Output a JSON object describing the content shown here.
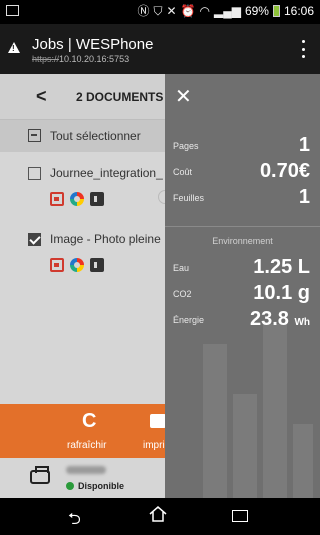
{
  "status_bar": {
    "battery": "69%",
    "time": "16:06"
  },
  "app_bar": {
    "title": "Jobs | WESPhone",
    "url_scheme": "https://",
    "url_host": "10.10.20.16:5753"
  },
  "doc_list": {
    "header": "2 DOCUMENTS",
    "select_all": "Tout sélectionner",
    "documents": [
      {
        "name": "Journee_integration_",
        "checked": false
      },
      {
        "name": "Image - Photo pleine",
        "checked": true
      }
    ]
  },
  "actions": {
    "refresh_label": "rafraîchir",
    "print_label": "impri"
  },
  "printer": {
    "status": "Disponible"
  },
  "summary": {
    "pages_label": "Pages",
    "pages_value": "1",
    "cost_label": "Coût",
    "cost_value": "0.70€",
    "sheets_label": "Feuilles",
    "sheets_value": "1",
    "env_title": "Environnement",
    "water_label": "Eau",
    "water_value": "1.25 L",
    "co2_label": "CO2",
    "co2_value": "10.1 g",
    "energy_label": "Énergie",
    "energy_value": "23.8",
    "energy_unit": "Wh"
  }
}
